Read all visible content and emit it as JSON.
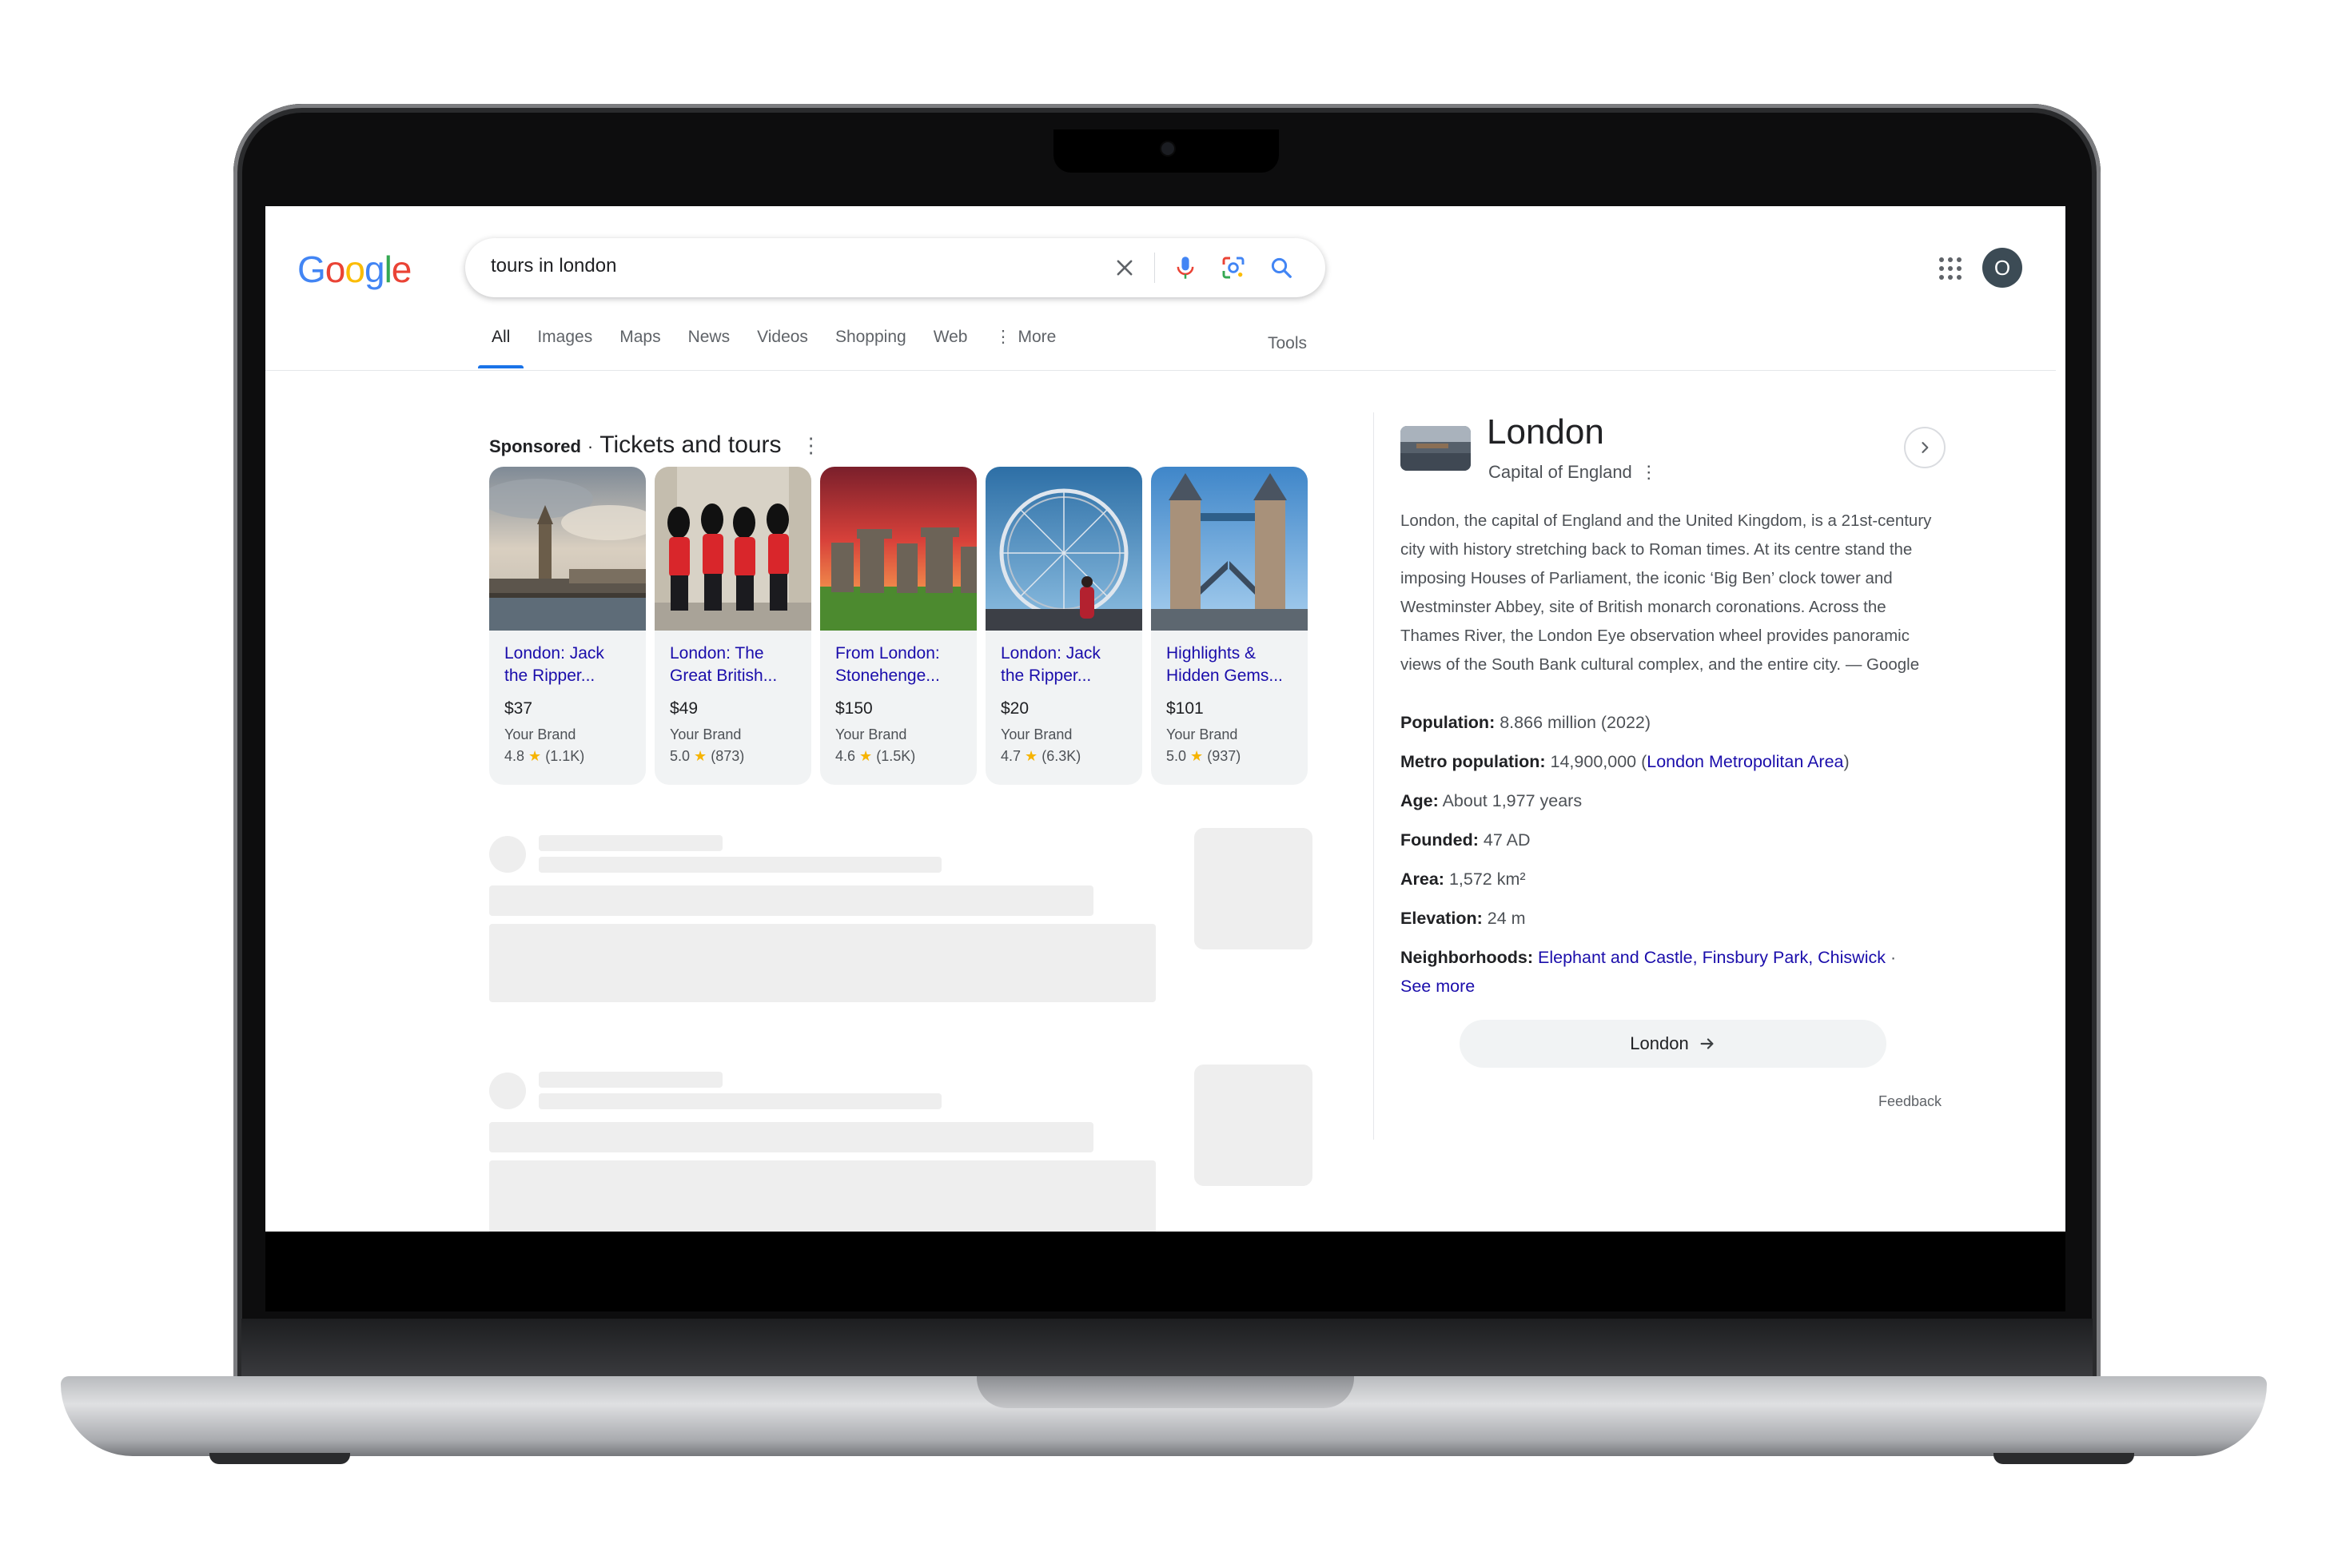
{
  "search": {
    "query": "tours in london",
    "icons": [
      "close-icon",
      "mic-icon",
      "lens-icon",
      "search-icon"
    ]
  },
  "logo": {
    "letters": [
      "G",
      "o",
      "o",
      "g",
      "l",
      "e"
    ],
    "colors": [
      "#4285F4",
      "#EA4335",
      "#FBBC05",
      "#4285F4",
      "#34A853",
      "#EA4335"
    ]
  },
  "account": {
    "initial": "O"
  },
  "tabs": [
    {
      "label": "All",
      "active": true
    },
    {
      "label": "Images"
    },
    {
      "label": "Maps"
    },
    {
      "label": "News"
    },
    {
      "label": "Videos"
    },
    {
      "label": "Shopping"
    },
    {
      "label": "Web"
    },
    {
      "label": "More"
    }
  ],
  "tools_label": "Tools",
  "sponsored": {
    "label": "Sponsored",
    "separator": "·",
    "title": "Tickets and tours",
    "cards": [
      {
        "title": "London: Jack the Ripper...",
        "price": "$37",
        "brand": "Your Brand",
        "rating": "4.8",
        "reviews": "(1.1K)"
      },
      {
        "title": "London: The Great British...",
        "price": "$49",
        "brand": "Your Brand",
        "rating": "5.0",
        "reviews": "(873)"
      },
      {
        "title": "From London: Stonehenge...",
        "price": "$150",
        "brand": "Your Brand",
        "rating": "4.6",
        "reviews": "(1.5K)"
      },
      {
        "title": "London: Jack the Ripper...",
        "price": "$20",
        "brand": "Your Brand",
        "rating": "4.7",
        "reviews": "(6.3K)"
      },
      {
        "title": "Highlights & Hidden Gems...",
        "price": "$101",
        "brand": "Your Brand",
        "rating": "5.0",
        "reviews": "(937)"
      }
    ]
  },
  "knowledge_panel": {
    "title": "London",
    "subtitle": "Capital of England",
    "description": "London, the capital of England and the United Kingdom, is a 21st-century city with history stretching back to Roman times. At its centre stand the imposing Houses of Parliament, the iconic ‘Big Ben’ clock tower and Westminster Abbey, site of British monarch coronations. Across the Thames River, the London Eye observation wheel provides panoramic views of the South Bank cultural complex, and the entire city. — Google",
    "facts": {
      "population_label": "Population:",
      "population_value": "8.866 million (2022)",
      "metro_label": "Metro population:",
      "metro_value": "14,900,000 (",
      "metro_link": "London Metropolitan Area",
      "metro_close": ")",
      "age_label": "Age:",
      "age_value": "About 1,977 years",
      "founded_label": "Founded:",
      "founded_value": "47 AD",
      "area_label": "Area:",
      "area_value": "1,572 km²",
      "elevation_label": "Elevation:",
      "elevation_value": "24 m",
      "neighborhoods_label": "Neighborhoods:",
      "neighborhoods_links": "Elephant and Castle, Finsbury Park, Chiswick",
      "neighborhoods_sep": " · ",
      "see_more": "See more"
    },
    "button_label": "London",
    "feedback": "Feedback"
  }
}
